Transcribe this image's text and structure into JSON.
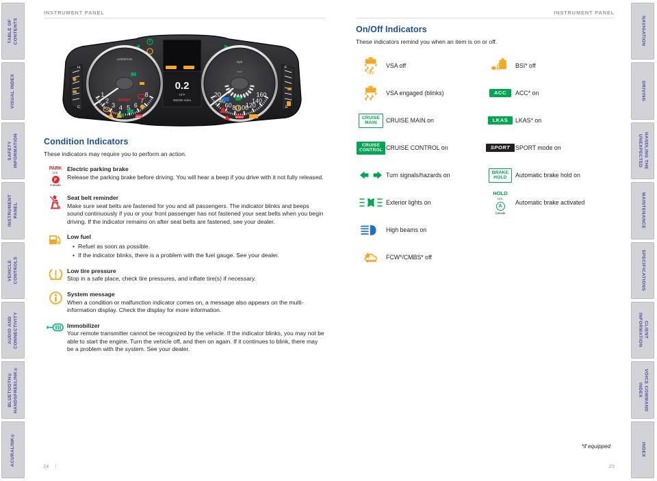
{
  "sidebar_left": {
    "items": [
      {
        "label": "TABLE OF\nCONTENTS"
      },
      {
        "label": "VISUAL INDEX"
      },
      {
        "label": "SAFETY\nINFORMATION"
      },
      {
        "label": "INSTRUMENT\nPANEL"
      },
      {
        "label": "VEHICLE\nCONTROLS"
      },
      {
        "label": "AUDIO AND\nCONNECTIVITY"
      },
      {
        "label": "BLUETOOTH®\nHANDSFREELINK®"
      },
      {
        "label": "ACURALINK®"
      }
    ]
  },
  "sidebar_right": {
    "items": [
      {
        "label": "NAVIGATION"
      },
      {
        "label": "DRIVING"
      },
      {
        "label": "HANDLING THE\nUNEXPECTED"
      },
      {
        "label": "MAINTENANCE"
      },
      {
        "label": "SPECIFICATIONS"
      },
      {
        "label": "CLIENT\nINFORMATION"
      },
      {
        "label": "VOICE COMMAND\nINDEX"
      },
      {
        "label": "INDEX"
      }
    ]
  },
  "left_page": {
    "running_head": "INSTRUMENT PANEL",
    "folio": "24",
    "section_title": "Condition Indicators",
    "lede": "These indicators may require you to perform an action.",
    "items": [
      {
        "icon": "electric-parking-brake-icon",
        "title": "Electric parking brake",
        "body": "Release the parking brake before driving. You will hear a beep if you drive with it not fully released.",
        "icon_text": {
          "us": "PARK",
          "us_caption": "U.S.",
          "canada": "P",
          "canada_caption": "Canada"
        }
      },
      {
        "icon": "seat-belt-reminder-icon",
        "title": "Seat belt reminder",
        "body": "Make sure seat belts are fastened for you and all passengers. The indicator blinks and beeps sound continuously if you or your front passenger has not fastened your seat belts when you begin driving. If the indicator remains on after seat belts are fastened, see your dealer."
      },
      {
        "icon": "low-fuel-icon",
        "title": "Low fuel",
        "bullets": [
          "Refuel as soon as possible.",
          "If the indicator blinks, there is a problem with the fuel gauge. See your dealer."
        ]
      },
      {
        "icon": "low-tire-pressure-icon",
        "title": "Low tire pressure",
        "body": "Stop in a safe place, check tire pressures, and inflate tire(s) if necessary."
      },
      {
        "icon": "system-message-icon",
        "title": "System message",
        "body": "When a condition or malfunction indicator comes on, a message also appears on the multi-information display. Check the display for more information."
      },
      {
        "icon": "immobilizer-icon",
        "title": "Immobilizer",
        "body": "Your remote transmitter cannot be recognized by the vehicle. If the indicator blinks, you may not be able to start the engine. Turn the vehicle off, and then on again. If it continues to blink, there may be a problem with the system. See your dealer."
      }
    ]
  },
  "cluster": {
    "tach_unit": "x1000r/min",
    "tach_ticks": [
      "1",
      "2",
      "3",
      "4",
      "5",
      "6",
      "7",
      "8"
    ],
    "speed_unit": "mph",
    "speed_ticks": [
      "20",
      "40",
      "60",
      "80",
      "100",
      "120",
      "140",
      "160"
    ],
    "speed_inner_unit": "km/h",
    "mid_gear": "0.2",
    "mid_temp": "73°F",
    "mid_odo": "082300 miles",
    "sport_label": "SPORT",
    "park_label": "PARK",
    "brake_label": "BRAKE",
    "fuel_h": "H",
    "fuel_c": "C",
    "fuel_f": "F",
    "fuel_e": "E"
  },
  "right_page": {
    "running_head": "INSTRUMENT PANEL",
    "folio": "25",
    "section_title": "On/Off Indicators",
    "lede": "These indicators remind you when an item is on or off.",
    "footnote": "*if equipped",
    "left_column": [
      {
        "icon": "vsa-off-icon",
        "badge": "",
        "label": "VSA off",
        "icon_caption": "OFF"
      },
      {
        "icon": "vsa-engaged-icon",
        "badge": "",
        "label": "VSA engaged (blinks)"
      },
      {
        "icon": "cruise-main-badge",
        "badge": "CRUISE\nMAIN",
        "badge_style": "out-green",
        "label": "CRUISE MAIN on"
      },
      {
        "icon": "cruise-control-badge",
        "badge": "CRUISE\nCONTROL",
        "badge_style": "fill-green",
        "label": "CRUISE CONTROL on"
      },
      {
        "icon": "turn-signal-arrows-icon",
        "badge": "",
        "label": "Turn signals/hazards on"
      },
      {
        "icon": "exterior-lights-icon",
        "badge": "",
        "label": "Exterior lights on"
      },
      {
        "icon": "high-beams-icon",
        "badge": "",
        "label": "High beams on"
      },
      {
        "icon": "fcw-cmbs-off-icon",
        "badge": "",
        "label": "FCW*/CMBS* off"
      }
    ],
    "right_column": [
      {
        "icon": "bsi-off-icon",
        "badge": "",
        "label": "BSI* off"
      },
      {
        "icon": "acc-badge",
        "badge": "ACC",
        "badge_style": "fill-green",
        "label": "ACC* on"
      },
      {
        "icon": "lkas-badge",
        "badge": "LKAS",
        "badge_style": "fill-green",
        "label": "LKAS* on"
      },
      {
        "icon": "sport-badge",
        "badge": "SPORT",
        "badge_style": "black",
        "label": "SPORT mode on"
      },
      {
        "icon": "brake-hold-badge",
        "badge": "BRAKE\nHOLD",
        "badge_style": "out-green",
        "label": "Automatic brake hold on"
      },
      {
        "icon": "automatic-brake-activated-icon",
        "badge": "HOLD",
        "us_caption": "U.S.",
        "canada_caption": "Canada",
        "label": "Automatic brake activated"
      }
    ]
  },
  "colors": {
    "accent_blue": "#1b4f9c",
    "green": "#00a651",
    "amber": "#f7a823",
    "red": "#e8262b",
    "tab_bg": "#d3d3d7",
    "tab_text": "#4a4f9e"
  }
}
